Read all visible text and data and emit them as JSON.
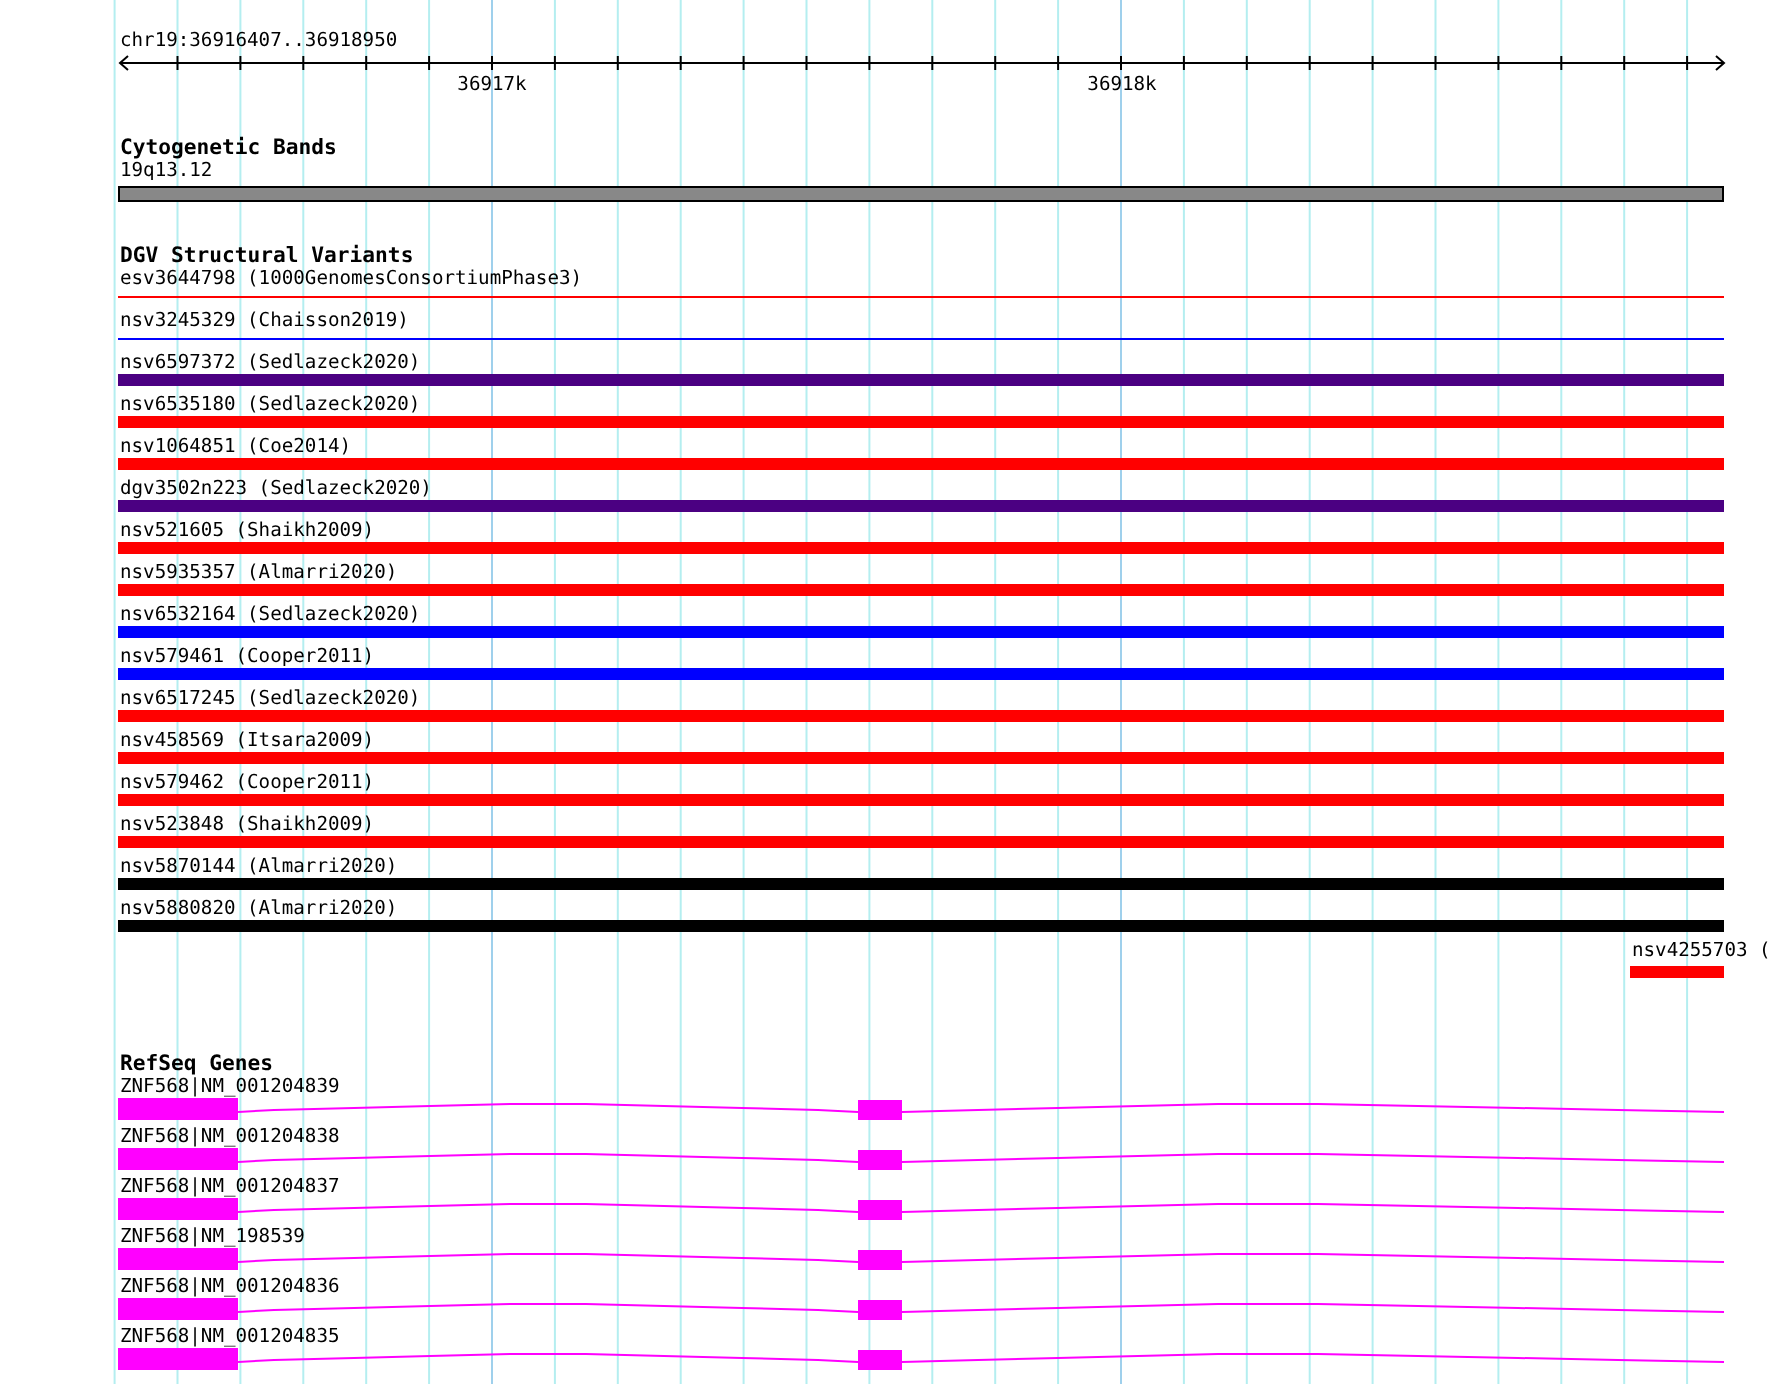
{
  "location": "chr19:36916407..36918950",
  "scale": {
    "ticks": [
      "36917k",
      "36918k"
    ]
  },
  "tracks": [
    {
      "kind": "cytoband",
      "title": "Cytogenetic Bands",
      "features": [
        {
          "label": "19q13.12"
        }
      ]
    },
    {
      "kind": "variants",
      "title": "DGV Structural Variants",
      "features": [
        {
          "label": "esv3644798 (1000GenomesConsortiumPhase3)",
          "kind": "thin",
          "color": "#ff0000"
        },
        {
          "label": "nsv3245329 (Chaisson2019)",
          "kind": "thin",
          "color": "#0000ff"
        },
        {
          "label": "nsv6597372 (Sedlazeck2020)",
          "kind": "thick",
          "color": "#4b0082"
        },
        {
          "label": "nsv6535180 (Sedlazeck2020)",
          "kind": "thick",
          "color": "#ff0000"
        },
        {
          "label": "nsv1064851 (Coe2014)",
          "kind": "thick",
          "color": "#ff0000"
        },
        {
          "label": "dgv3502n223 (Sedlazeck2020)",
          "kind": "thick",
          "color": "#4b0082"
        },
        {
          "label": "nsv521605 (Shaikh2009)",
          "kind": "thick",
          "color": "#ff0000"
        },
        {
          "label": "nsv5935357 (Almarri2020)",
          "kind": "thick",
          "color": "#ff0000"
        },
        {
          "label": "nsv6532164 (Sedlazeck2020)",
          "kind": "thick",
          "color": "#0000ff"
        },
        {
          "label": "nsv579461 (Cooper2011)",
          "kind": "thick",
          "color": "#0000ff"
        },
        {
          "label": "nsv6517245 (Sedlazeck2020)",
          "kind": "thick",
          "color": "#ff0000"
        },
        {
          "label": "nsv458569 (Itsara2009)",
          "kind": "thick",
          "color": "#ff0000"
        },
        {
          "label": "nsv579462 (Cooper2011)",
          "kind": "thick",
          "color": "#ff0000"
        },
        {
          "label": "nsv523848 (Shaikh2009)",
          "kind": "thick",
          "color": "#ff0000"
        },
        {
          "label": "nsv5870144 (Almarri2020)",
          "kind": "thick",
          "color": "#000000"
        },
        {
          "label": "nsv5880820 (Almarri2020)",
          "kind": "thick",
          "color": "#000000"
        },
        {
          "label": "nsv4255703 (",
          "kind": "partial",
          "color": "#ff0000"
        }
      ]
    },
    {
      "kind": "genes",
      "title": "RefSeq Genes",
      "features": [
        {
          "label": "ZNF568|NM_001204839"
        },
        {
          "label": "ZNF568|NM_001204838"
        },
        {
          "label": "ZNF568|NM_001204837"
        },
        {
          "label": "ZNF568|NM_198539"
        },
        {
          "label": "ZNF568|NM_001204836"
        },
        {
          "label": "ZNF568|NM_001204835"
        }
      ]
    }
  ]
}
